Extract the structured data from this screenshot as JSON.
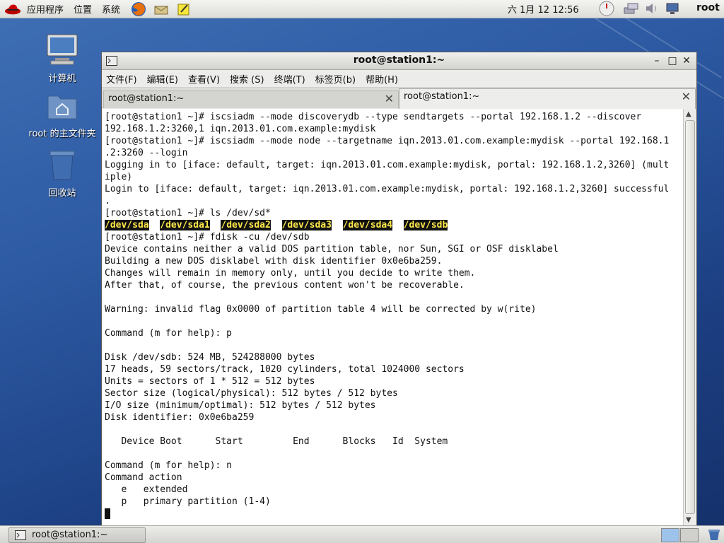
{
  "top_panel": {
    "menus": [
      "应用程序",
      "位置",
      "系统"
    ],
    "clock": "六 1月 12 12:56",
    "user": "root"
  },
  "desktop": {
    "icons": [
      "计算机",
      "root 的主文件夹",
      "回收站"
    ]
  },
  "window": {
    "title": "root@station1:~",
    "menu": [
      "文件(F)",
      "编辑(E)",
      "查看(V)",
      "搜索 (S)",
      "终端(T)",
      "标签页(b)",
      "帮助(H)"
    ],
    "tabs": [
      "root@station1:~",
      "root@station1:~"
    ],
    "terminal_lines": [
      "[root@station1 ~]# iscsiadm --mode discoverydb --type sendtargets --portal 192.168.1.2 --discover",
      "192.168.1.2:3260,1 iqn.2013.01.com.example:mydisk",
      "[root@station1 ~]# iscsiadm --mode node --targetname iqn.2013.01.com.example:mydisk --portal 192.168.1",
      ".2:3260 --login",
      "Logging in to [iface: default, target: iqn.2013.01.com.example:mydisk, portal: 192.168.1.2,3260] (mult",
      "iple)",
      "Login to [iface: default, target: iqn.2013.01.com.example:mydisk, portal: 192.168.1.2,3260] successful",
      ".",
      "[root@station1 ~]# ls /dev/sd*"
    ],
    "devices": [
      "/dev/sda",
      "/dev/sda1",
      "/dev/sda2",
      "/dev/sda3",
      "/dev/sda4",
      "/dev/sdb"
    ],
    "terminal_lines_2": [
      "[root@station1 ~]# fdisk -cu /dev/sdb",
      "Device contains neither a valid DOS partition table, nor Sun, SGI or OSF disklabel",
      "Building a new DOS disklabel with disk identifier 0x0e6ba259.",
      "Changes will remain in memory only, until you decide to write them.",
      "After that, of course, the previous content won't be recoverable.",
      "",
      "Warning: invalid flag 0x0000 of partition table 4 will be corrected by w(rite)",
      "",
      "Command (m for help): p",
      "",
      "Disk /dev/sdb: 524 MB, 524288000 bytes",
      "17 heads, 59 sectors/track, 1020 cylinders, total 1024000 sectors",
      "Units = sectors of 1 * 512 = 512 bytes",
      "Sector size (logical/physical): 512 bytes / 512 bytes",
      "I/O size (minimum/optimal): 512 bytes / 512 bytes",
      "Disk identifier: 0x0e6ba259",
      "",
      "   Device Boot      Start         End      Blocks   Id  System",
      "",
      "Command (m for help): n",
      "Command action",
      "   e   extended",
      "   p   primary partition (1-4)"
    ]
  },
  "taskbar": {
    "task_label": "root@station1:~"
  }
}
